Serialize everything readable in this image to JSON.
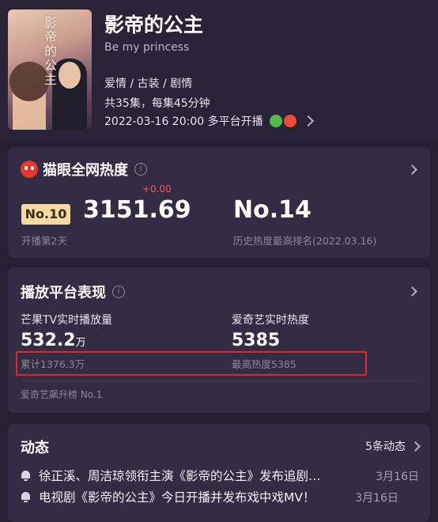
{
  "show": {
    "title": "影帝的公主",
    "subtitle": "Be my princess",
    "genre": "爱情 / 古装 / 剧情",
    "episodes": "共35集，每集45分钟",
    "air": "2022-03-16 20:00 多平台开播",
    "poster_title": "影帝的公主"
  },
  "heat": {
    "title": "猫眼全网热度",
    "rank_badge": "No.10",
    "value": "3151.69",
    "delta": "+0.00",
    "days": "开播第2天",
    "best_rank": "No.14",
    "best_rank_label": "历史热度最高排名(2022.03.16)"
  },
  "platform": {
    "title": "播放平台表现",
    "mango_label": "芒果TV实时播放量",
    "mango_value": "532.2",
    "mango_unit": "万",
    "mango_total": "累计1376.3万",
    "iqiyi_label": "爱奇艺实时热度",
    "iqiyi_value": "5385",
    "iqiyi_max": "最高热度5385",
    "iqiyi_chart": "爱奇艺飙升榜 No.1"
  },
  "news": {
    "title": "动态",
    "count": "5条动态",
    "items": [
      {
        "text": "徐正溪、周洁琼领衔主演《影帝的公主》发布追剧…",
        "date": "3月16日"
      },
      {
        "text": "电视剧《影帝的公主》今日开播并发布戏中戏MV！",
        "date": "3月16日"
      }
    ]
  },
  "colors": {
    "background": "#262033",
    "card": "#342c43",
    "badge": "#f4d9a4",
    "delta": "#ff4f5e",
    "highlight_box": "#e2262b"
  }
}
